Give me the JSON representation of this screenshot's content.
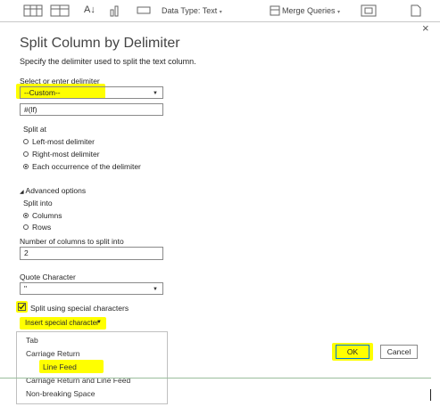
{
  "toolbar": {
    "data_type_label": "Data Type: Text",
    "merge_queries_label": "Merge Queries"
  },
  "dialog": {
    "title": "Split Column by Delimiter",
    "subtitle": "Specify the delimiter used to split the text column.",
    "delimiter_label": "Select or enter delimiter",
    "delimiter_value": "--Custom--",
    "custom_value": "#(lf)",
    "split_at_label": "Split at",
    "split_at_options": [
      "Left-most delimiter",
      "Right-most delimiter",
      "Each occurrence of the delimiter"
    ],
    "split_at_selected": 2,
    "advanced_label": "Advanced options",
    "split_into_label": "Split into",
    "split_into_options": [
      "Columns",
      "Rows"
    ],
    "split_into_selected": 0,
    "num_columns_label": "Number of columns to split into",
    "num_columns_value": "2",
    "quote_label": "Quote Character",
    "quote_value": "\"",
    "special_chars_label": "Split using special characters",
    "special_chars_checked": true,
    "insert_special_label": "Insert special character",
    "menu_items": [
      "Tab",
      "Carriage Return",
      "Line Feed",
      "Carriage Return and Line Feed",
      "Non-breaking Space"
    ],
    "menu_highlighted": 2,
    "ok_label": "OK",
    "cancel_label": "Cancel",
    "close_glyph": "×"
  },
  "colors": {
    "highlight": "#ffff00",
    "accent": "#0078d4"
  }
}
